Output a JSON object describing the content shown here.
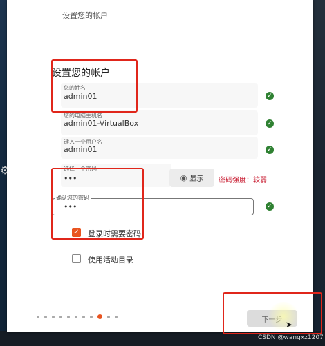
{
  "window": {
    "title": "设置您的帐户"
  },
  "form": {
    "heading": "设置您的帐户",
    "name": {
      "label": "您的姓名",
      "value": "admin01"
    },
    "computer": {
      "label": "您的电脑主机名",
      "value": "admin01-VirtualBox"
    },
    "username": {
      "label": "键入一个用户名",
      "value": "admin01"
    },
    "password": {
      "label": "选择一个密码",
      "value": "•••"
    },
    "show_button": "显示",
    "strength": "密码强度：较弱",
    "confirm": {
      "label": "确认您的密码",
      "value": "•••"
    },
    "require_password": {
      "label": "登录时需要密码",
      "checked": true
    },
    "active_directory": {
      "label": "使用活动目录",
      "checked": false
    },
    "check_symbol": "✓"
  },
  "navigation": {
    "total_steps": 11,
    "current_step": 9,
    "next_label": "下一步"
  },
  "watermark": "CSDN @wangxz1207",
  "icons": {
    "eye": "eye-icon",
    "check": "check-icon",
    "cursor": "mouse-cursor-icon",
    "side": "puzzle-icon"
  },
  "colors": {
    "accent": "#e95420",
    "check_green": "#2f8132",
    "warning_red": "#c7162b",
    "highlight": "#e0261b"
  }
}
